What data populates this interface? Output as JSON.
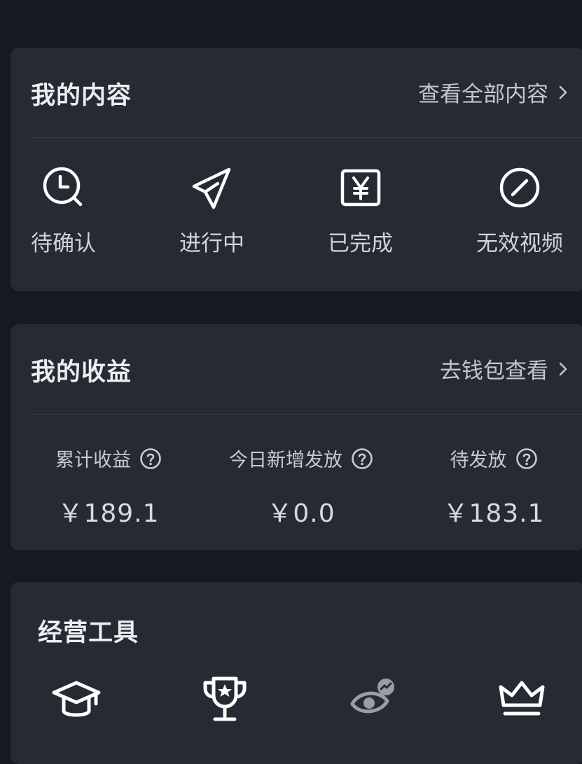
{
  "content": {
    "title": "我的内容",
    "link": "查看全部内容",
    "items": [
      {
        "label": "待确认",
        "icon": "clock-search-icon"
      },
      {
        "label": "进行中",
        "icon": "paper-plane-icon"
      },
      {
        "label": "已完成",
        "icon": "yen-box-icon"
      },
      {
        "label": "无效视频",
        "icon": "circle-slash-icon"
      }
    ]
  },
  "earnings": {
    "title": "我的收益",
    "link": "去钱包查看",
    "metrics": [
      {
        "label": "累计收益",
        "value": "￥189.1"
      },
      {
        "label": "今日新增发放",
        "value": "￥0.0"
      },
      {
        "label": "待发放",
        "value": "￥183.1"
      }
    ]
  },
  "tools": {
    "title": "经营工具",
    "icons": [
      "graduation-cap-icon",
      "trophy-icon",
      "eye-trend-icon",
      "crown-icon"
    ]
  },
  "colors": {
    "background": "#161922",
    "card": "#262a32",
    "text": "#e6e7ea",
    "muted": "#c3c6cc"
  }
}
